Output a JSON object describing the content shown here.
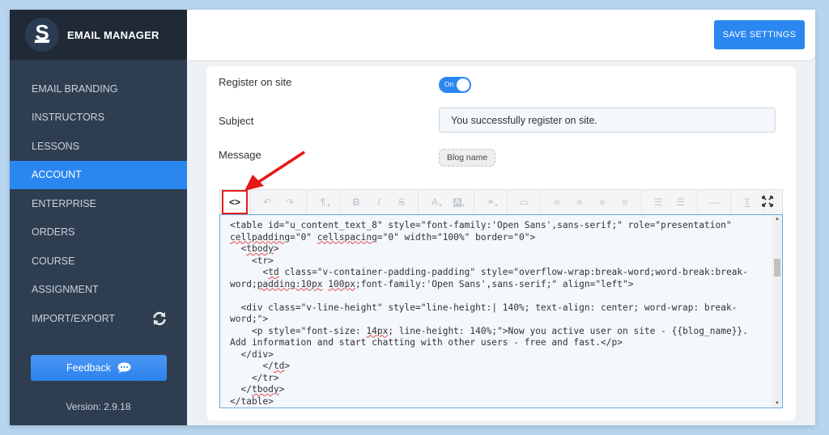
{
  "app": {
    "title": "EMAIL MANAGER",
    "logo_letter": "S",
    "version": "Version: 2.9.18"
  },
  "sidebar": {
    "items": [
      {
        "label": "EMAIL BRANDING",
        "active": false
      },
      {
        "label": "INSTRUCTORS",
        "active": false
      },
      {
        "label": "LESSONS",
        "active": false
      },
      {
        "label": "ACCOUNT",
        "active": true
      },
      {
        "label": "ENTERPRISE",
        "active": false
      },
      {
        "label": "ORDERS",
        "active": false
      },
      {
        "label": "COURSE",
        "active": false
      },
      {
        "label": "ASSIGNMENT",
        "active": false
      },
      {
        "label": "IMPORT/EXPORT",
        "active": false,
        "icon": "sync-icon"
      }
    ],
    "feedback_label": "Feedback"
  },
  "header": {
    "save_label": "SAVE SETTINGS"
  },
  "form": {
    "register_label": "Register on site",
    "register_toggle": {
      "state": "on",
      "label": "On"
    },
    "subject_label": "Subject",
    "subject_value": "You successfully register on site.",
    "message_label": "Message",
    "tag_chip": "Blog name"
  },
  "editor": {
    "toolbar": [
      {
        "name": "source-code",
        "glyph": "<>",
        "highlighted": true
      },
      {
        "name": "undo",
        "glyph": "↶"
      },
      {
        "name": "redo",
        "glyph": "↷"
      },
      {
        "name": "paragraph",
        "glyph": "¶"
      },
      {
        "name": "bold",
        "glyph": "B"
      },
      {
        "name": "italic",
        "glyph": "I"
      },
      {
        "name": "strikethrough",
        "glyph": "S"
      },
      {
        "name": "font-color",
        "glyph": "A"
      },
      {
        "name": "background-color",
        "glyph": "A"
      },
      {
        "name": "link",
        "glyph": "⚭"
      },
      {
        "name": "image",
        "glyph": "▭"
      },
      {
        "name": "align-left",
        "glyph": "≡"
      },
      {
        "name": "align-center",
        "glyph": "≡"
      },
      {
        "name": "align-right",
        "glyph": "≡"
      },
      {
        "name": "align-justify",
        "glyph": "≡"
      },
      {
        "name": "bullet-list",
        "glyph": "☰"
      },
      {
        "name": "numbered-list",
        "glyph": "☰"
      },
      {
        "name": "horizontal-rule",
        "glyph": "—"
      },
      {
        "name": "clear-format",
        "glyph": "T"
      },
      {
        "name": "fullscreen",
        "glyph": "⤢"
      }
    ],
    "code_lines": [
      "<table id=\"u_content_text_8\" style=\"font-family:'Open Sans',sans-serif;\" role=\"presentation\" cellpadding=\"0\" cellspacing=\"0\" width=\"100%\" border=\"0\">",
      "  <tbody>",
      "    <tr>",
      "      <td class=\"v-container-padding-padding\" style=\"overflow-wrap:break-word;word-break:break-word;padding:10px 100px;font-family:'Open Sans',sans-serif;\" align=\"left\">",
      "",
      "  <div class=\"v-line-height\" style=\"line-height:| 140%; text-align: center; word-wrap: break-word;\">",
      "    <p style=\"font-size: 14px; line-height: 140%;\">Now you active user on site - {{blog_name}}. Add information and start chatting with other users - free and fast.</p>",
      "  </div>",
      "      </td>",
      "    </tr>",
      "  </tbody>",
      "</table>"
    ]
  },
  "colors": {
    "accent": "#2a87f0",
    "sidebar_bg": "#2e3e50",
    "brand_bg": "#1f2a36",
    "highlight_box": "#e02020"
  }
}
